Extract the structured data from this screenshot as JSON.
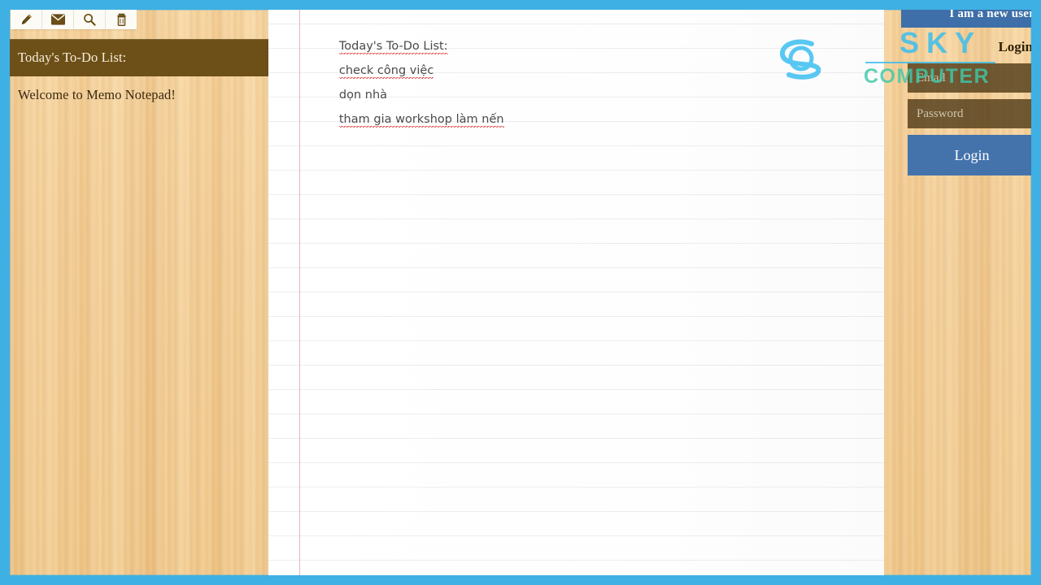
{
  "app": {
    "frame_color": "#3FB0E3",
    "wood_color": "#F2CA90"
  },
  "toolbar": {
    "buttons": [
      {
        "name": "new-note",
        "icon": "pencil-icon",
        "title": "New note"
      },
      {
        "name": "mail-note",
        "icon": "envelope-icon",
        "title": "Mail note"
      },
      {
        "name": "search-note",
        "icon": "search-icon",
        "title": "Search"
      },
      {
        "name": "delete-note",
        "icon": "trash-icon",
        "title": "Delete note"
      }
    ]
  },
  "sidebar": {
    "notes": [
      {
        "title": "Today's To-Do List:",
        "selected": true
      },
      {
        "title": "Welcome to Memo Notepad!",
        "selected": false
      }
    ]
  },
  "note": {
    "lines": [
      {
        "text": "Today's To-Do List:",
        "misspelled": true
      },
      {
        "text": "check công việc",
        "misspelled": true
      },
      {
        "text": "dọn nhà",
        "misspelled": false
      },
      {
        "text": "tham gia workshop làm nến",
        "misspelled": true
      }
    ]
  },
  "login": {
    "new_user_label": "I am a new user",
    "title": "Login",
    "email_placeholder": "Email",
    "email_value": "",
    "password_placeholder": "Password",
    "password_value": "",
    "login_button_label": "Login",
    "bar_color": "#3E6FA8",
    "button_color": "#4473AC"
  },
  "watermark": {
    "line1": "SKY",
    "line2": "COMPUTER",
    "color_primary": "#35BDF0",
    "color_secondary": "#3FC9A8"
  }
}
